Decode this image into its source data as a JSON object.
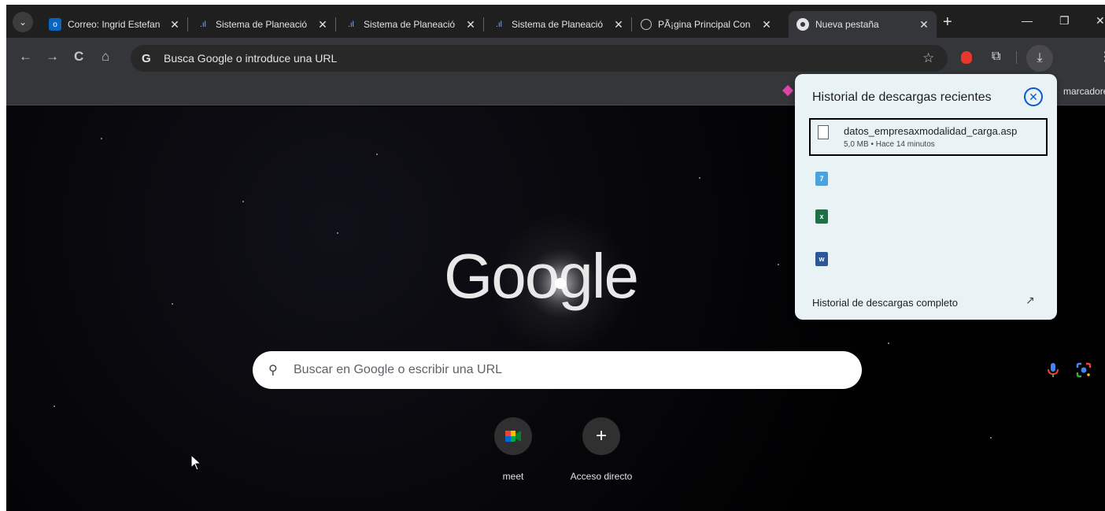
{
  "tabs": [
    {
      "title": "Correo: Ingrid Estefan",
      "favicon": "outlook-icon",
      "active": false
    },
    {
      "title": "Sistema de Planeació",
      "favicon": "planning-system-icon",
      "active": false
    },
    {
      "title": "Sistema de Planeació",
      "favicon": "planning-system-icon",
      "active": false
    },
    {
      "title": "Sistema de Planeació",
      "favicon": "planning-system-icon",
      "active": false
    },
    {
      "title": "PÃ¡gina Principal Con",
      "favicon": "globe-icon",
      "active": false
    },
    {
      "title": "Nueva pestaña",
      "favicon": "chrome-icon",
      "active": true
    }
  ],
  "omnibox": {
    "placeholder": "Busca Google o introduce una URL"
  },
  "bookmarks_bar": {
    "right_label": "marcadore"
  },
  "newtab": {
    "logo_text": "Google",
    "search_placeholder": "Buscar en Google o escribir una URL",
    "shortcuts": [
      {
        "label": "meet",
        "icon": "google-meet-icon"
      },
      {
        "label": "Acceso directo",
        "icon": "plus-icon"
      }
    ]
  },
  "downloads_panel": {
    "title": "Historial de descargas recientes",
    "item": {
      "filename": "datos_empresaxmodalidad_carga.asp",
      "meta": "5,0 MB • Hace 14 minutos"
    },
    "other_items": [
      "installer-file-icon",
      "excel-file-icon",
      "word-file-icon"
    ],
    "footer_link": "Historial de descargas completo"
  },
  "colors": {
    "accent": "#0b57d0",
    "panel_bg": "#e9f3f6",
    "toolbar_bg": "#35363a"
  }
}
